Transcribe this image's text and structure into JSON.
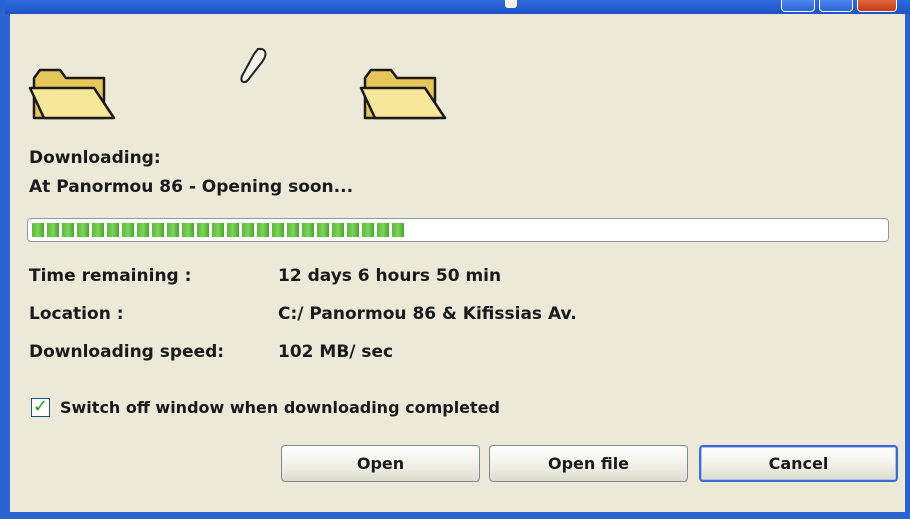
{
  "window": {
    "title_fragment": "",
    "accent": "#2c63d2",
    "close_color": "#c23a18"
  },
  "icons": {
    "source_folder": "folder-icon",
    "destination_folder": "folder-icon",
    "flying_document": "document-icon"
  },
  "download": {
    "heading": "Downloading:",
    "item": "At Panormou 86 - Opening soon...",
    "progress_fraction": 0.44,
    "progress_color": "#5bb83a"
  },
  "details": [
    {
      "label": "Time remaining :",
      "value": "12 days 6 hours 50 min"
    },
    {
      "label": "Location :",
      "value": "C:/ Panormou 86 & Kifissias Av."
    },
    {
      "label": "Downloading speed:",
      "value": "102 MB/ sec"
    }
  ],
  "option": {
    "checked": true,
    "label": "Switch off window when downloading completed"
  },
  "buttons": {
    "open": "Open",
    "open_file": "Open file",
    "cancel": "Cancel"
  }
}
